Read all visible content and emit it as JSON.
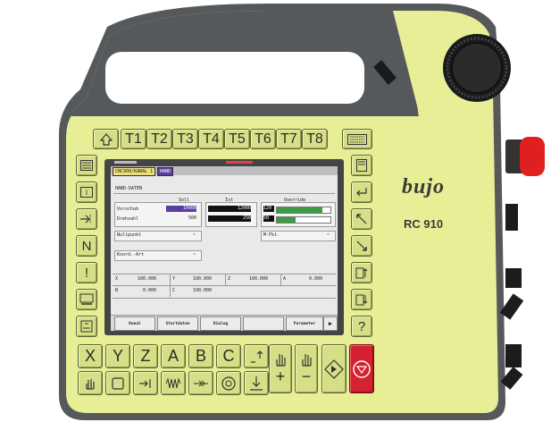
{
  "colors": {
    "body": "#e8ee96",
    "frame": "#55595c",
    "screen_bg": "#e9e9e9",
    "header_bg": "#c8b4d8",
    "value_purple": "#5b3fa0",
    "bar_green": "#3c9c46",
    "emergency": "#d42230",
    "key": "#d7df86"
  },
  "branding": {
    "logo": "bujo",
    "model": "RC 910"
  },
  "top_keys": {
    "shift_icon": "up-arrow",
    "labels": [
      "T1",
      "T2",
      "T3",
      "T4",
      "T5",
      "T6",
      "T7",
      "T8"
    ],
    "keyboard_icon": "keyboard"
  },
  "left_keys": [
    {
      "name": "list-icon"
    },
    {
      "label": "i"
    },
    {
      "name": "enter-arrow-icon"
    },
    {
      "label": "N"
    },
    {
      "label": "!"
    },
    {
      "name": "monitor-icon"
    },
    {
      "name": "mode-icon"
    }
  ],
  "right_keys": [
    {
      "name": "page-icon"
    },
    {
      "name": "return-icon"
    },
    {
      "name": "diagonal-up-icon"
    },
    {
      "name": "diagonal-down-icon"
    },
    {
      "name": "file-up-icon"
    },
    {
      "name": "file-down-icon"
    },
    {
      "label": "?"
    }
  ],
  "bottom_row1": [
    "X",
    "Y",
    "Z",
    "A",
    "B",
    "C"
  ],
  "bottom_row2_icons": [
    "hand-icon",
    "frame-icon",
    "step-icon",
    "wave-icon",
    "jog-icon",
    "circle-icon",
    "down-icon"
  ],
  "screen": {
    "title": "CNC900/KANAL 1",
    "mode": "HAND",
    "section": "HAND-DATEN",
    "soll_label": "Soll",
    "ist_label": "Ist",
    "override_label": "Override",
    "vorschub_label": "Vorschub",
    "drehzahl_label": "Drehzahl",
    "soll_vorschub": "10000",
    "soll_drehzahl": "500",
    "ist_vorschub": "12000",
    "ist_drehzahl": "250",
    "override_vorschub": "120",
    "override_drehzahl": "50",
    "override_vorschub_fraction": 0.85,
    "override_drehzahl_fraction": 0.35,
    "nullpunkt": "Nullpunkt",
    "nullpunkt_sel": "~",
    "mfkt": "M-Fkt.",
    "mfkt_sel": "~",
    "koord": "Koord.-Art",
    "koord_sel": "~",
    "coords": [
      {
        "axis": "X",
        "value": "100.000"
      },
      {
        "axis": "Y",
        "value": "100.000"
      },
      {
        "axis": "Z",
        "value": "100.000"
      },
      {
        "axis": "A",
        "value": "0.000"
      },
      {
        "axis": "B",
        "value": "0.000"
      },
      {
        "axis": "C",
        "value": "100.000"
      }
    ],
    "softkeys": [
      "Kanal",
      "Startdaten",
      "Dialog",
      "",
      "Parameter"
    ],
    "next_arrow": "▶"
  },
  "status_keys": {
    "hand_plus": "+",
    "hand_minus": "−"
  }
}
